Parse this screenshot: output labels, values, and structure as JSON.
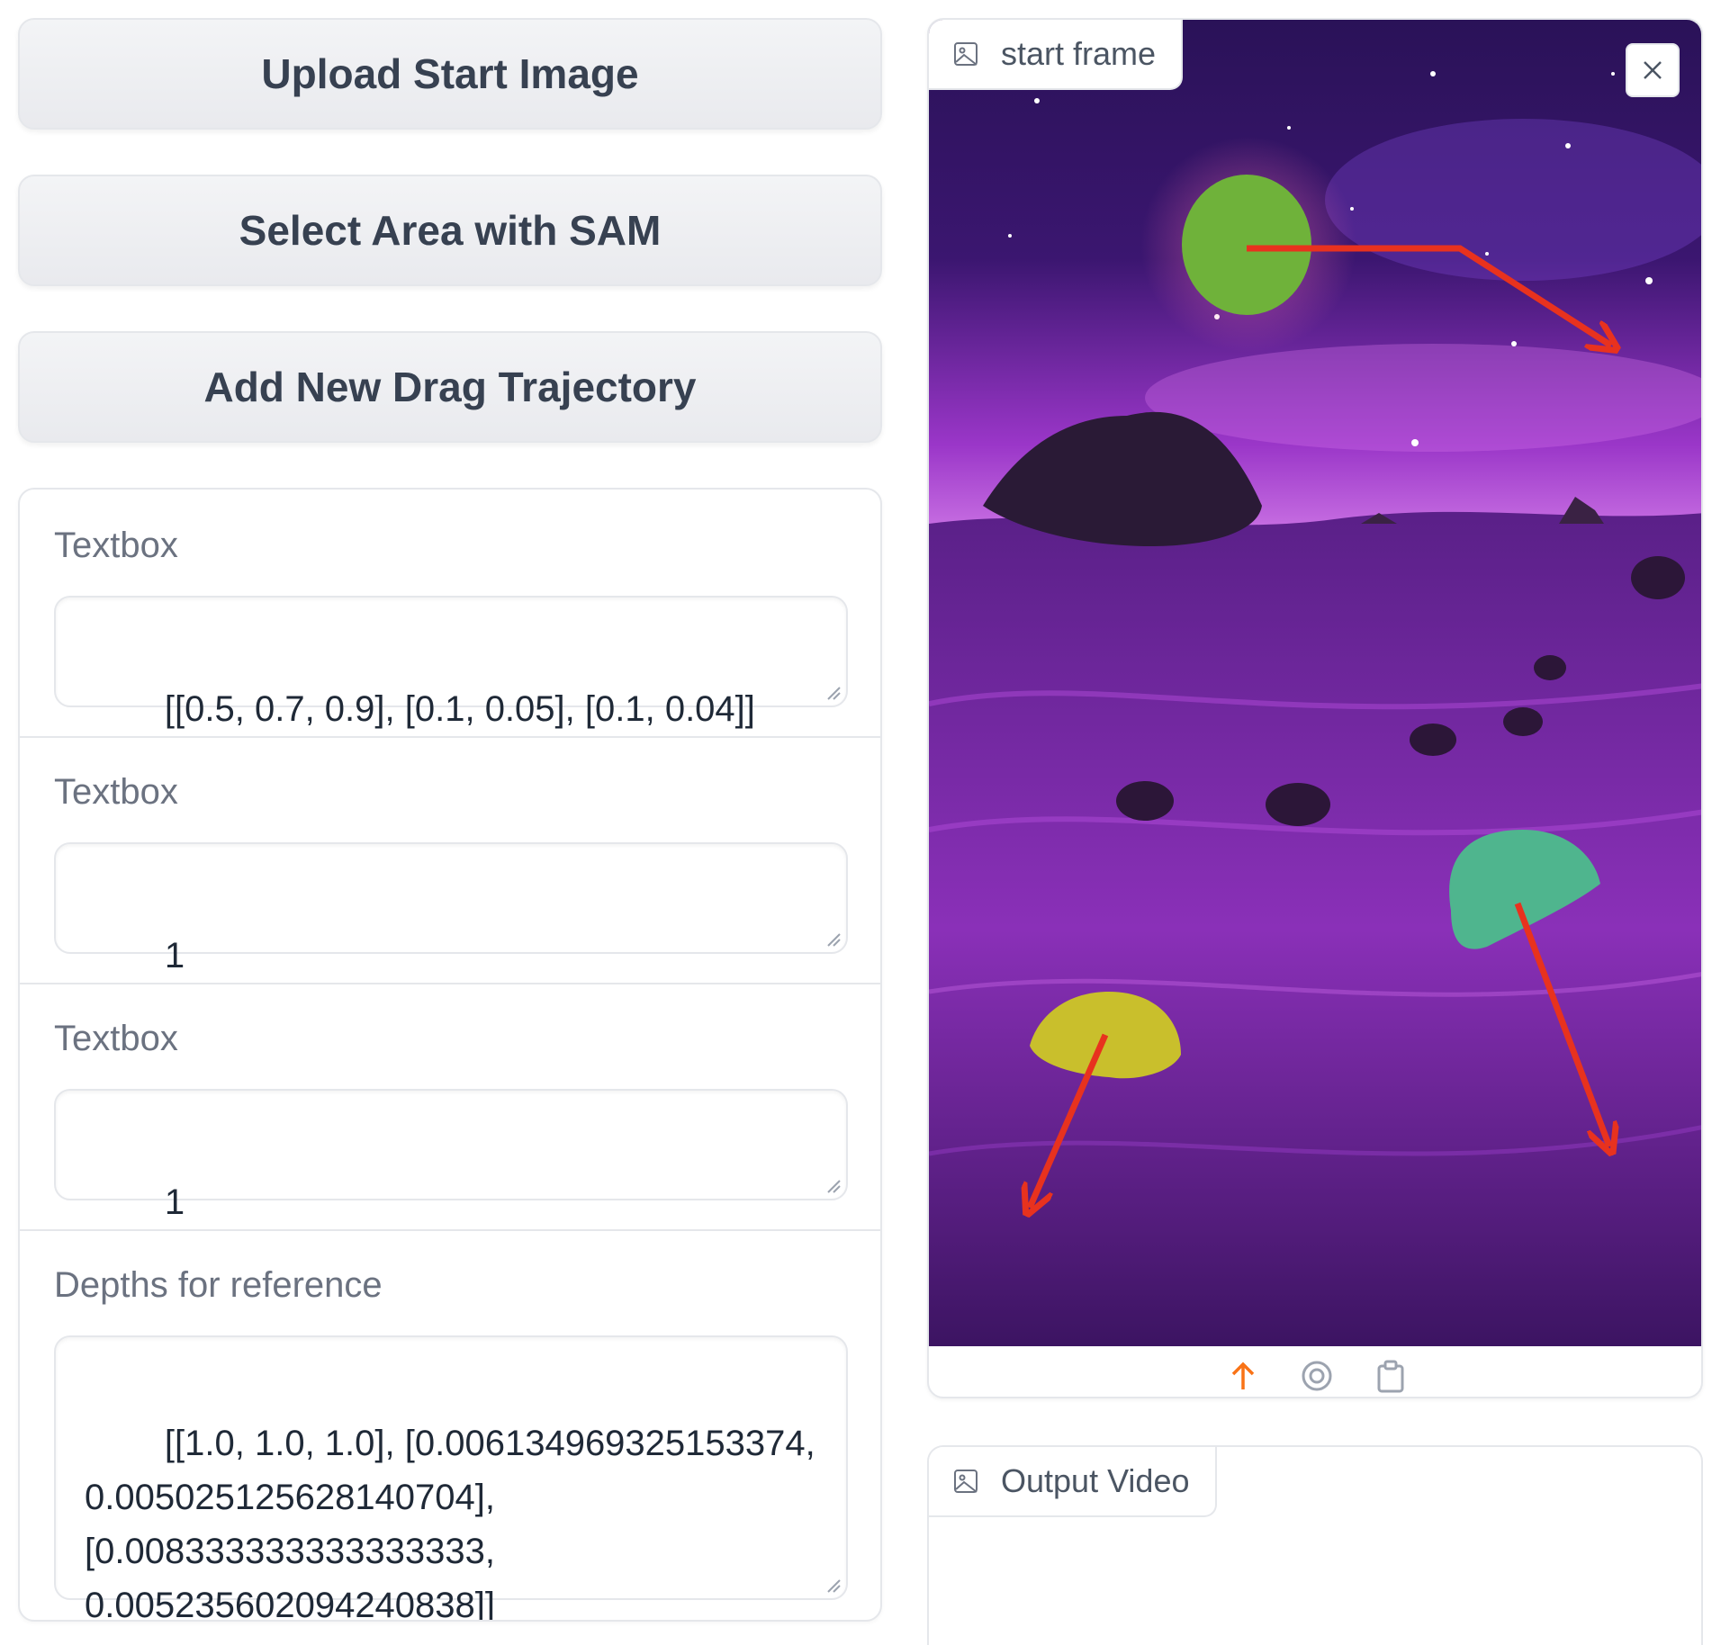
{
  "buttons": {
    "upload_start_image": "Upload Start Image",
    "select_area_sam": "Select Area with SAM",
    "add_drag_trajectory": "Add New Drag Trajectory"
  },
  "fields": [
    {
      "label": "Textbox",
      "value": "[[0.5, 0.7, 0.9], [0.1, 0.05], [0.1, 0.04]]"
    },
    {
      "label": "Textbox",
      "value": "1"
    },
    {
      "label": "Textbox",
      "value": "1"
    },
    {
      "label": "Depths for reference",
      "value": "[[1.0, 1.0, 1.0], [0.006134969325153374, 0.005025125628140704], [0.008333333333333333, 0.005235602094240838]]"
    }
  ],
  "start_frame": {
    "label": "start frame",
    "icons": [
      "image-icon",
      "close-icon",
      "upload-icon",
      "webcam-icon",
      "clipboard-icon"
    ]
  },
  "output_video": {
    "label": "Output Video",
    "icon": "image-icon"
  },
  "colors": {
    "accent": "#f97316",
    "trajectory_arrow": "#e8321e",
    "mask_green": "#6fb23a",
    "mask_teal": "#4fb58e",
    "mask_yellow": "#c9bf2c",
    "sky": "#2a1258",
    "ground": "#7a2aa6"
  }
}
